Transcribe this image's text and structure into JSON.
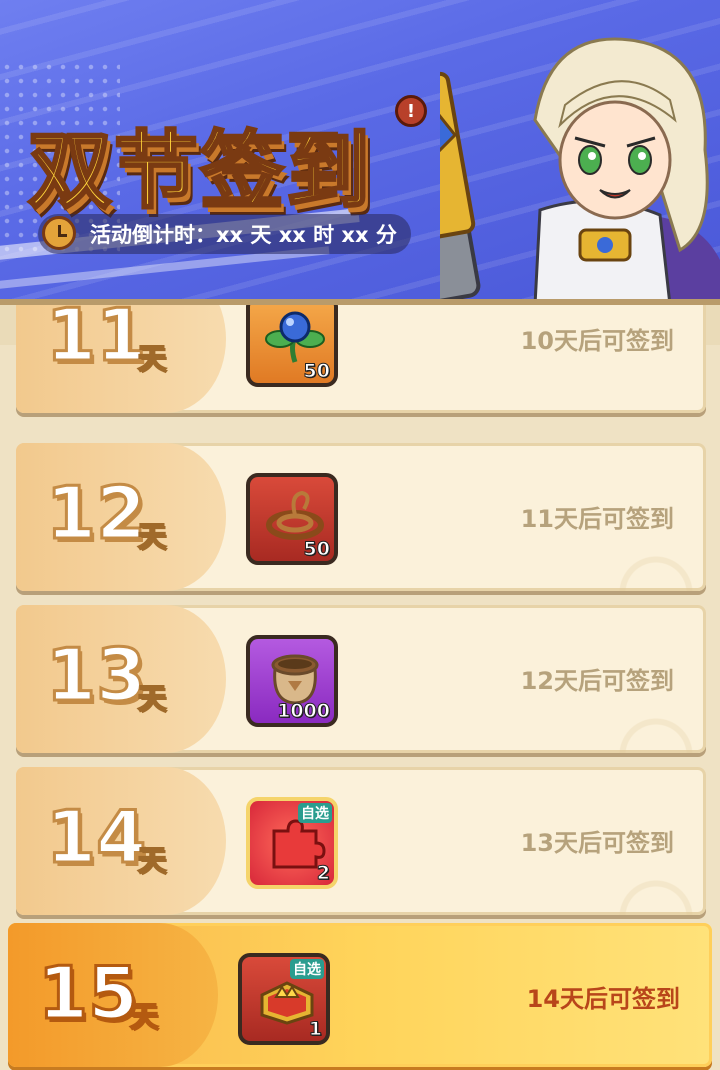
{
  "banner": {
    "title": "双节签到",
    "countdown": "活动倒计时：xx 天 xx 时 xx 分",
    "info_icon": "!"
  },
  "colors": {
    "banner_bg": "#5a6ae6",
    "title_fill": "#ffd43b",
    "row_bg": "#fbf1da",
    "highlight_row": "#ffd45a",
    "status_text": "#b6a27c",
    "highlight_status_text": "#b8451a"
  },
  "rows": [
    {
      "day": "11",
      "unit": "天",
      "item_icon": "flower-icon",
      "qty": "50",
      "tag": "",
      "status": "10天后可签到",
      "highlight": false
    },
    {
      "day": "12",
      "unit": "天",
      "item_icon": "rope-icon",
      "qty": "50",
      "tag": "",
      "status": "11天后可签到",
      "highlight": false
    },
    {
      "day": "13",
      "unit": "天",
      "item_icon": "sack-icon",
      "qty": "1000",
      "tag": "",
      "status": "12天后可签到",
      "highlight": false
    },
    {
      "day": "14",
      "unit": "天",
      "item_icon": "puzzle-icon",
      "qty": "2",
      "tag": "自选",
      "status": "13天后可签到",
      "highlight": false
    },
    {
      "day": "15",
      "unit": "天",
      "item_icon": "crown-box-icon",
      "qty": "1",
      "tag": "自选",
      "status": "14天后可签到",
      "highlight": true
    }
  ]
}
